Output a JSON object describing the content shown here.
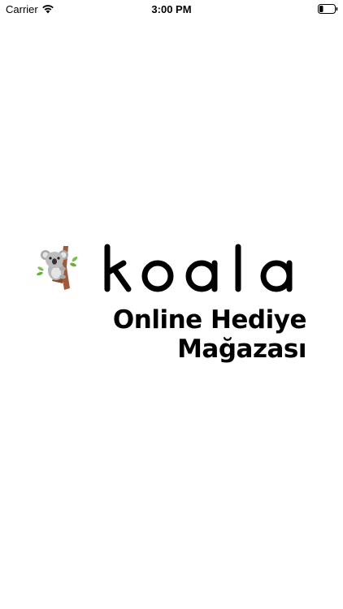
{
  "status_bar": {
    "carrier": "Carrier",
    "time": "3:00 PM",
    "wifi_icon": "wifi-icon",
    "battery_icon": "battery-low-icon",
    "battery_level": 0.25
  },
  "splash": {
    "brand_name": "koala",
    "mascot_icon": "koala-on-branch-icon",
    "tagline_line1": "Online Hediye",
    "tagline_line2": "Mağazası"
  },
  "colors": {
    "background": "#ffffff",
    "text": "#000000",
    "koala_gray": "#b8b8b8",
    "branch_brown": "#a05a3a",
    "leaf_green": "#7cbf4a"
  }
}
